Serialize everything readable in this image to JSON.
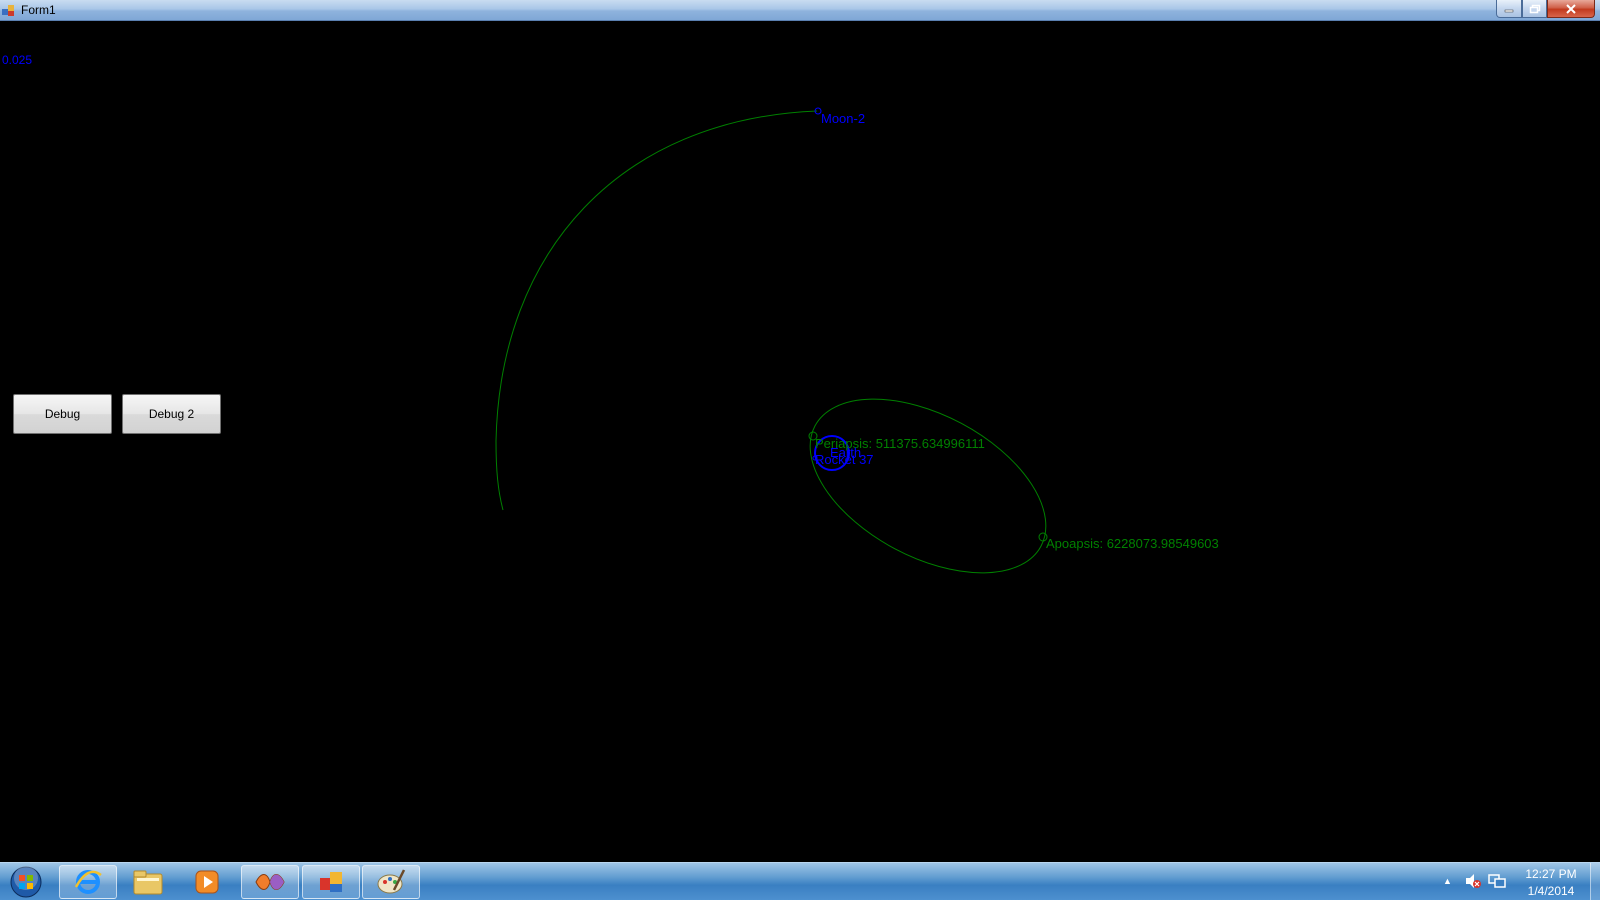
{
  "window": {
    "title": "Form1"
  },
  "canvas": {
    "zoom_readout": "0.025",
    "background": "#000000",
    "orbit_color": "#008000",
    "body_color": "#0000ff",
    "labels": {
      "moon": "Moon-2",
      "periapsis": "Periapsis: 511375.634996111",
      "apoapsis": "Apoapsis: 6228073.98549603",
      "earth": "Earth",
      "rocket": "Rocket 37"
    }
  },
  "buttons": {
    "debug": "Debug",
    "debug2": "Debug 2"
  },
  "taskbar": {
    "items": [
      "start-orb",
      "internet-explorer",
      "explorer",
      "media-player",
      "visual-studio",
      "control-panel",
      "paint"
    ],
    "clock": {
      "time": "12:27 PM",
      "date": "1/4/2014"
    }
  }
}
